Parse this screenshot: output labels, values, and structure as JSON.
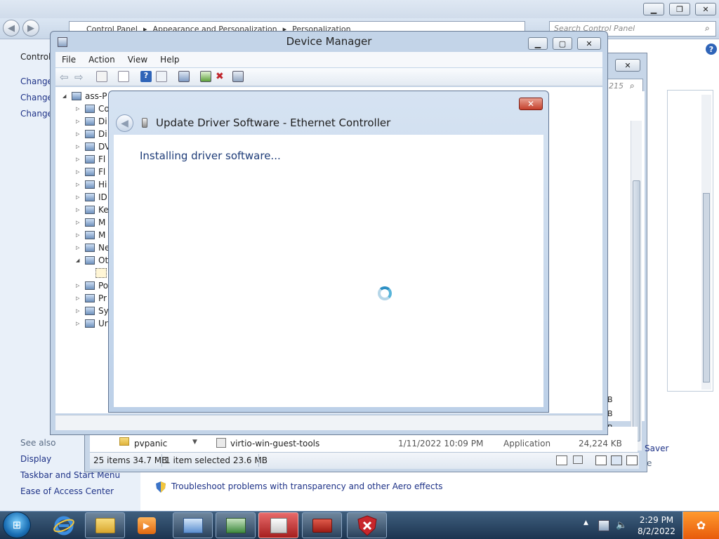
{
  "control_panel": {
    "address_parts": [
      "Control Panel",
      "Appearance and Personalization",
      "Personalization"
    ],
    "search_placeholder": "Search Control Panel",
    "left_title": "Control",
    "left_links": [
      "Change",
      "Change",
      "Change"
    ],
    "see_also_label": "See also",
    "see_also_links": [
      "Display",
      "Taskbar and Start Menu",
      "Ease of Access Center"
    ],
    "troubleshoot_link": "Troubleshoot problems with transparency and other Aero effects",
    "saver_text": "Saver",
    "help_label": "?"
  },
  "middle_window": {
    "search_fragment": "215",
    "size_fragments": [
      "B",
      "B",
      "B"
    ],
    "file_rows": [
      {
        "left_name": "pvpanic",
        "name": "virtio-win-guest-tools",
        "date": "1/11/2022 10:09 PM",
        "type": "Application",
        "size": "24,224 KB"
      }
    ],
    "status": {
      "items": "25 items  34.7 MB",
      "selected": "1 item selected  23.6 MB"
    },
    "frag_e": "e"
  },
  "device_manager": {
    "title": "Device Manager",
    "menu": [
      "File",
      "Action",
      "View",
      "Help"
    ],
    "tree_root": "ass-P",
    "tree_items": [
      {
        "label": "Co"
      },
      {
        "label": "Di"
      },
      {
        "label": "Di"
      },
      {
        "label": "DV"
      },
      {
        "label": "Fl"
      },
      {
        "label": "Fl"
      },
      {
        "label": "Hi"
      },
      {
        "label": "ID"
      },
      {
        "label": "Ke"
      },
      {
        "label": "M"
      },
      {
        "label": "M"
      },
      {
        "label": "Ne"
      },
      {
        "label": "Ot"
      },
      {
        "label": ""
      },
      {
        "label": "Po"
      },
      {
        "label": "Pr"
      },
      {
        "label": "Sy"
      },
      {
        "label": "Ur"
      }
    ]
  },
  "dialog": {
    "title": "Update Driver Software - Ethernet Controller",
    "message": "Installing driver software...",
    "close_label": "✕"
  },
  "taskbar": {
    "time": "2:29 PM",
    "date": "8/2/2022",
    "start_glyph": "⊞"
  }
}
